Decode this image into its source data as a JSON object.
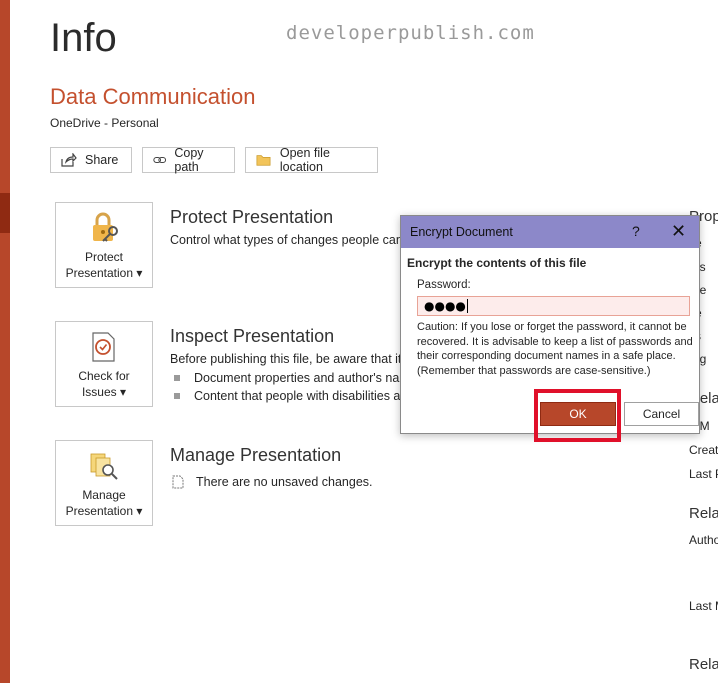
{
  "watermark": "developerpublish.com",
  "page": {
    "title": "Info"
  },
  "document": {
    "name": "Data Communication",
    "location": "OneDrive - Personal"
  },
  "actions": {
    "share": "Share",
    "copy_path": "Copy path",
    "open_location": "Open file location"
  },
  "protect": {
    "tile_label": "Protect Presentation",
    "heading": "Protect Presentation",
    "description": "Control what types of changes people can m"
  },
  "inspect": {
    "tile_label": "Check for Issues",
    "heading": "Inspect Presentation",
    "description": "Before publishing this file, be aware that it c",
    "items": [
      "Document properties and author's nam",
      "Content that people with disabilities are"
    ]
  },
  "manage": {
    "tile_label": "Manage Presentation",
    "heading": "Manage Presentation",
    "status": "There are no unsaved changes."
  },
  "properties": {
    "heading": "Prop",
    "rows": [
      "e",
      "es",
      "de",
      "e",
      "s",
      "eg"
    ],
    "related_dates_heading": "Rela",
    "dates": [
      "t M",
      "Creat",
      "Last P"
    ],
    "related_people_heading": "Rela",
    "people": [
      "Autho",
      "Last M"
    ],
    "related_docs_heading": "Rela"
  },
  "dialog": {
    "title": "Encrypt Document",
    "help": "?",
    "heading": "Encrypt the contents of this file",
    "password_label": "Password:",
    "password_value": "●●●●",
    "caution": "Caution: If you lose or forget the password, it cannot be recovered. It is advisable to keep a list of passwords and their corresponding document names in a safe place.\n(Remember that passwords are case-sensitive.)",
    "ok_label": "OK",
    "cancel_label": "Cancel"
  },
  "colors": {
    "accent": "#b7472a",
    "dialog_titlebar": "#8c88c9",
    "highlight": "#e0102a"
  }
}
